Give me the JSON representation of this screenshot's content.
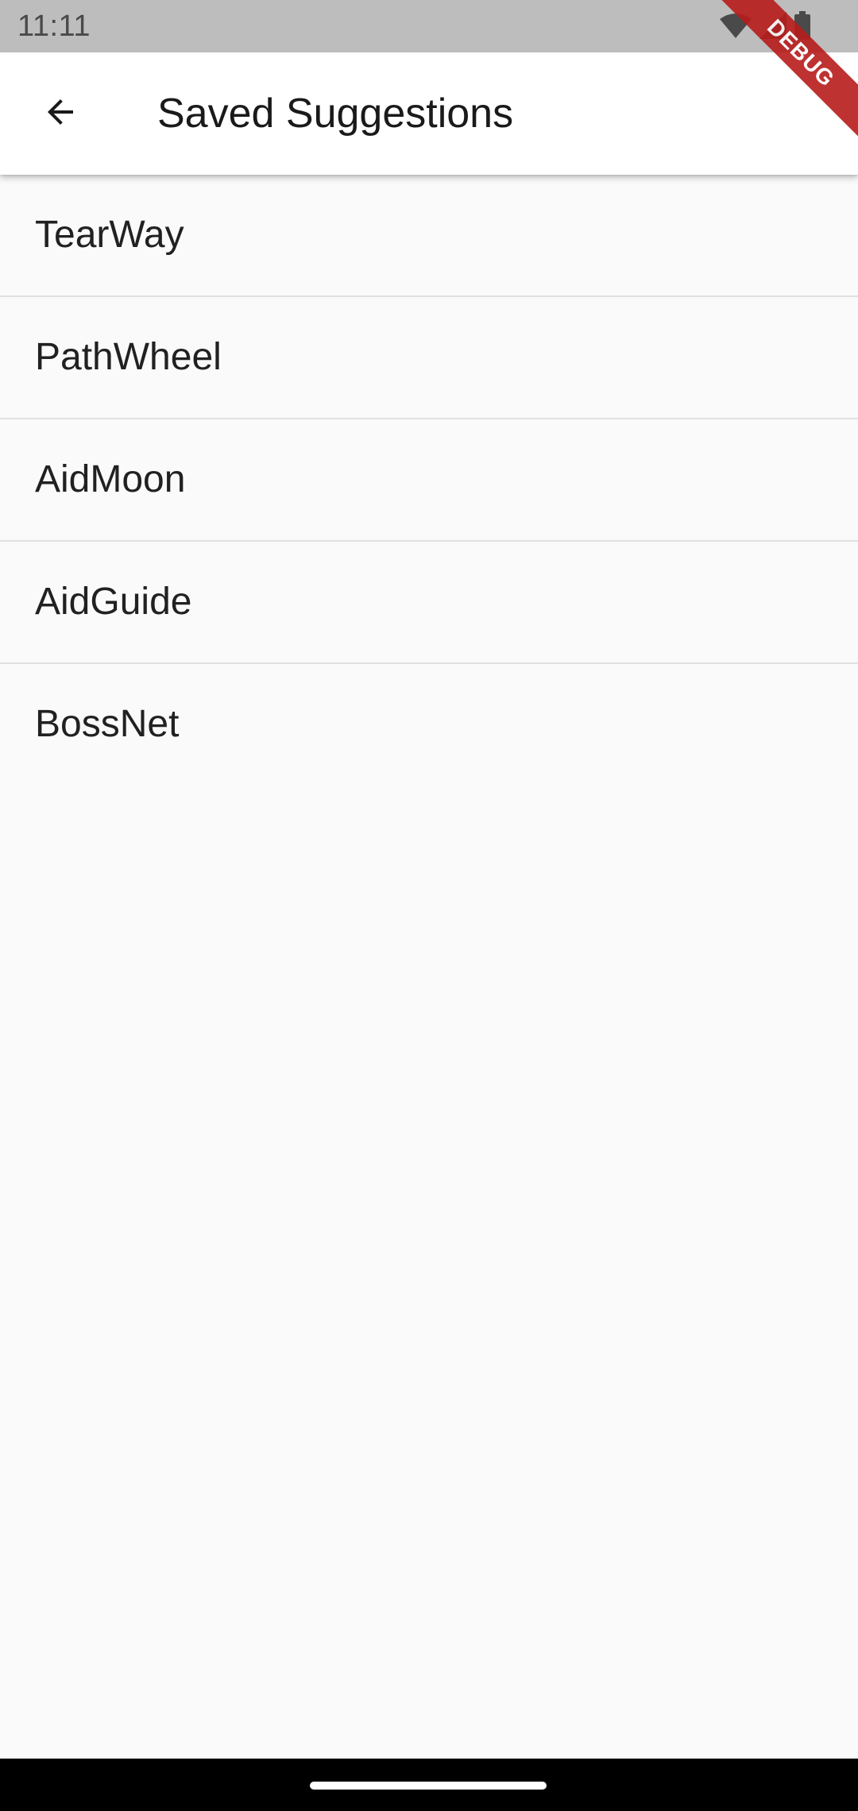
{
  "status_bar": {
    "time": "11:11",
    "icons": [
      "wifi-icon",
      "signal-icon",
      "battery-icon"
    ]
  },
  "app_bar": {
    "title": "Saved Suggestions",
    "back_icon": "arrow-back-icon"
  },
  "saved_list": {
    "items": [
      {
        "label": "TearWay"
      },
      {
        "label": "PathWheel"
      },
      {
        "label": "AidMoon"
      },
      {
        "label": "AidGuide"
      },
      {
        "label": "BossNet"
      }
    ]
  },
  "debug_banner": {
    "label": "DEBUG"
  },
  "colors": {
    "status_bar_bg": "#bdbdbd",
    "app_bar_bg": "#ffffff",
    "page_bg": "#fafafa",
    "divider": "#e0e0e0",
    "debug_banner": "#b71c1c",
    "nav_bar_bg": "#000000"
  }
}
